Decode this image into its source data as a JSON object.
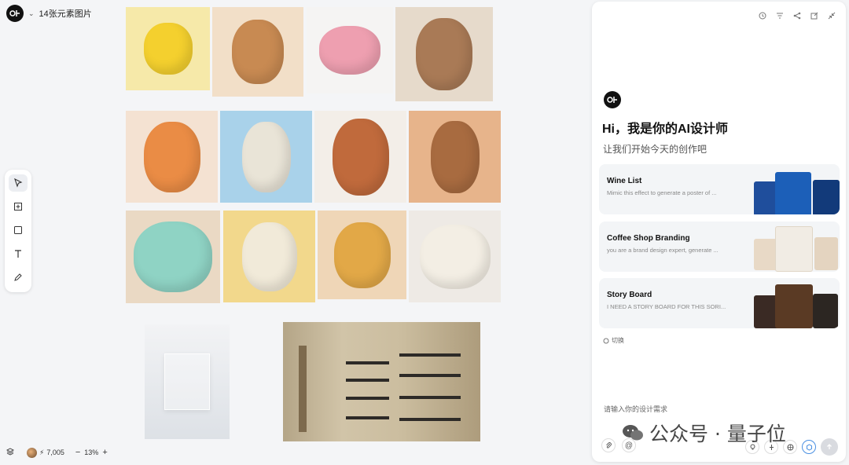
{
  "header": {
    "title": "14张元素图片"
  },
  "status": {
    "credits": "7,005",
    "zoom": "13%"
  },
  "panel": {
    "greeting": "Hi，我是你的AI设计师",
    "subtitle": "让我们开始今天的创作吧",
    "cards": [
      {
        "title": "Wine List",
        "desc": "Mimic this effect to generate a poster of ..."
      },
      {
        "title": "Coffee Shop Branding",
        "desc": "you are a brand design expert, generate ..."
      },
      {
        "title": "Story Board",
        "desc": "I NEED A STORY BOARD FOR THIS SORI..."
      }
    ],
    "switch_label": "切换",
    "input_placeholder": "请输入你的设计需求"
  },
  "watermark": {
    "text": "公众号 · 量子位"
  },
  "canvas_images": [
    "chick-figure",
    "puppy-figure",
    "pig-figure",
    "monkey-figure",
    "tiger-figure",
    "dragon-figure",
    "horse-figure",
    "ox-figure",
    "snake-figure",
    "mouse-figure",
    "dog-figure",
    "sheep-figure",
    "glass-box-image",
    "shelf-interior-image"
  ]
}
